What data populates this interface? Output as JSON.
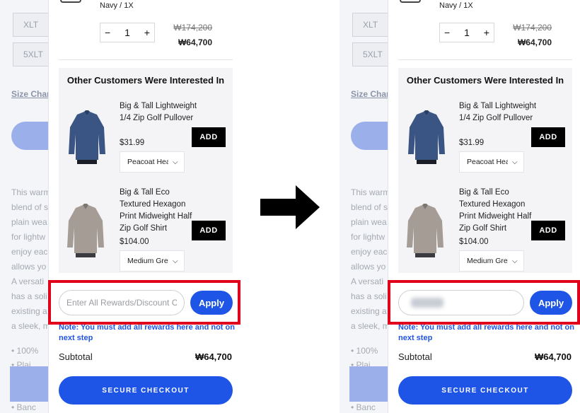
{
  "colors": {
    "accent": "#1f55e6",
    "highlight": "#e0001b",
    "add_button": "#000000"
  },
  "icons": {
    "transition": "right-arrow-icon",
    "dropdown": "chevron-down-icon"
  },
  "background_page": {
    "sizes": [
      "XLT",
      "5XLT"
    ],
    "size_chart_link": "Size Chart",
    "description_fragments": [
      "This warm",
      "blend of s",
      "plain wea",
      "for lightw",
      "enjoy eac",
      "allows yo",
      "A versati",
      "has a soli",
      "existing a",
      "a sleek, m"
    ],
    "bullets": [
      "100%",
      "Plai",
      "Banc"
    ]
  },
  "cart_item": {
    "variant": "Navy / 1X",
    "quantity": "1",
    "minus": "−",
    "plus": "+",
    "original_price": "₩174,200",
    "price": "₩64,700"
  },
  "recommendations": {
    "title": "Other Customers Were Interested In",
    "items": [
      {
        "name": "Big & Tall Lightweight 1/4 Zip Golf Pullover",
        "price": "$31.99",
        "color": "Peacoat Hea",
        "add_label": "ADD"
      },
      {
        "name": "Big & Tall Eco Textured Hexagon Print Midweight Half Zip Golf Shirt",
        "price": "$104.00",
        "color": "Medium Grey",
        "add_label": "ADD"
      }
    ]
  },
  "discount": {
    "placeholder": "Enter All Rewards/Discount Codes",
    "apply_label": "Apply",
    "note": "Note: You must add all rewards here and not on next step"
  },
  "summary": {
    "subtotal_label": "Subtotal",
    "subtotal_value": "₩64,700",
    "checkout_label": "SECURE CHECKOUT"
  }
}
